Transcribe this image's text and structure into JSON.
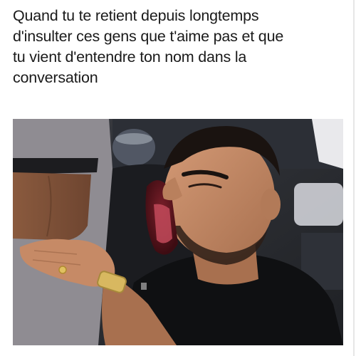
{
  "meme": {
    "caption_lines": [
      "Quand tu te retient depuis longtemps",
      "d'insulter ces gens que t'aime pas et que",
      "tu vient d'entendre ton nom dans la",
      "conversation"
    ]
  },
  "colors": {
    "background": "#ffffff",
    "text": "#1a1a1a",
    "shirt": "#0f1012",
    "skin": "#c68a66",
    "grey_shirt": "#8f8c92"
  }
}
